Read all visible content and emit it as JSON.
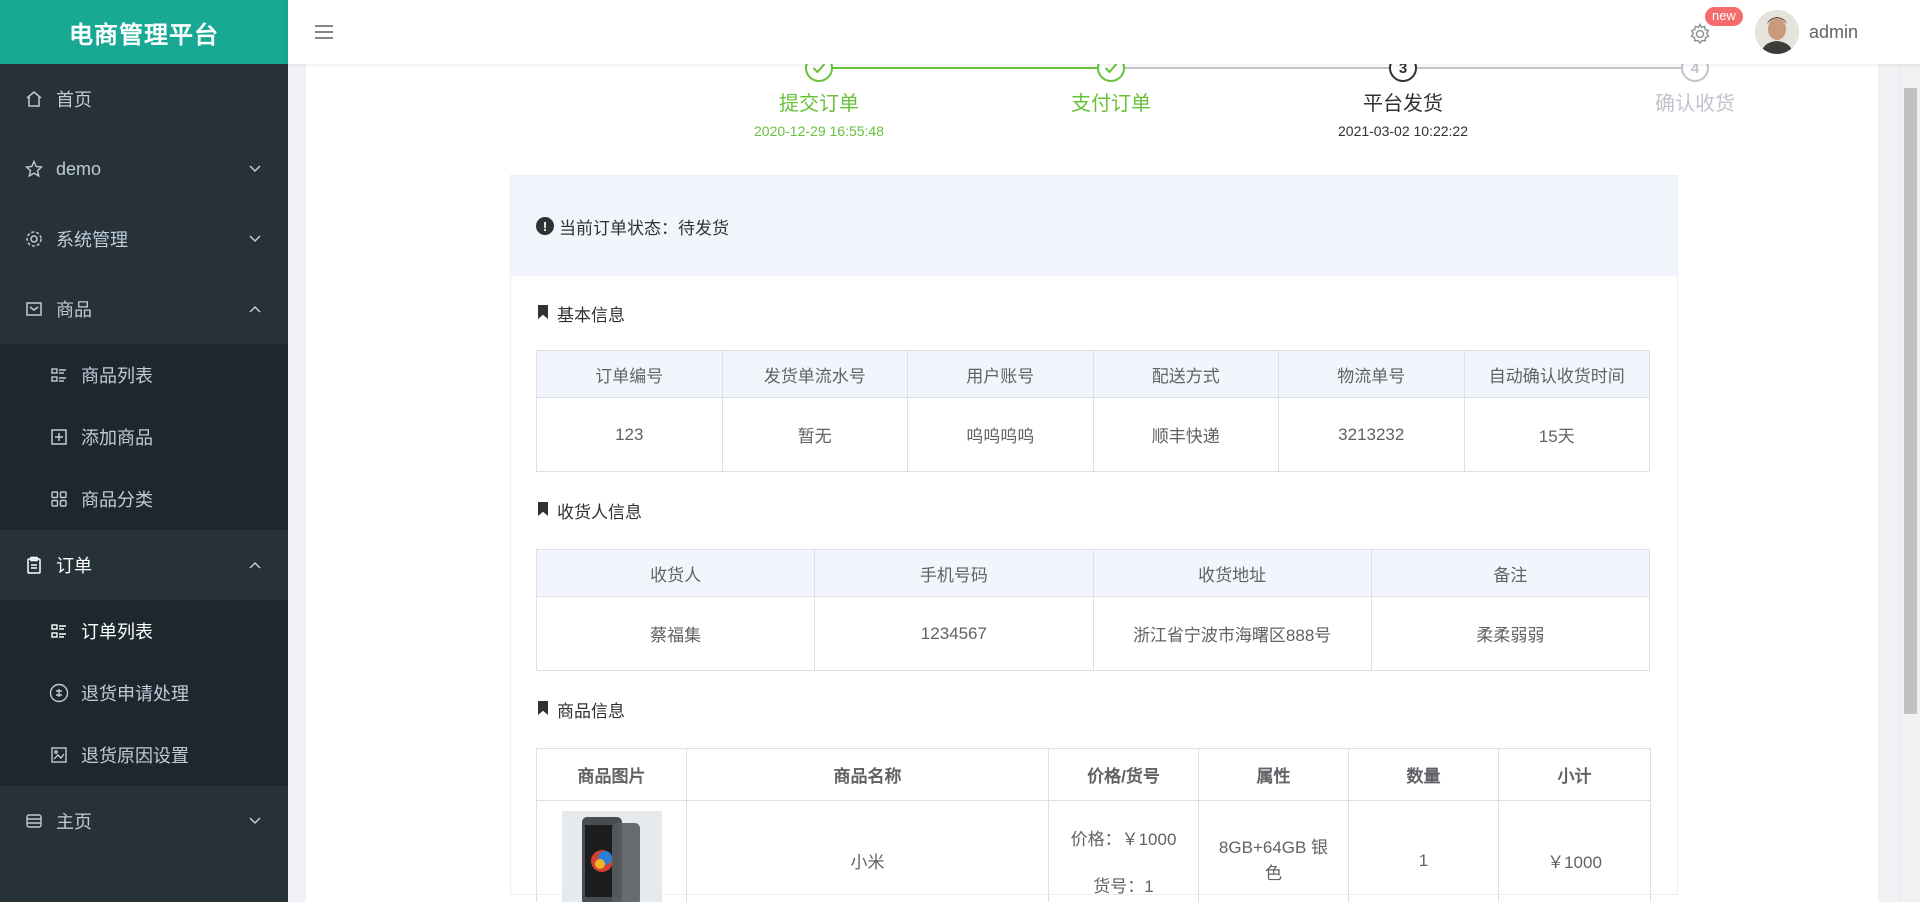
{
  "app": {
    "title": "电商管理平台"
  },
  "sidebar": {
    "items": [
      {
        "label": "首页",
        "icon": "home-icon"
      },
      {
        "label": "demo",
        "icon": "star-icon"
      },
      {
        "label": "系统管理",
        "icon": "gear-icon"
      },
      {
        "label": "商品",
        "icon": "inbox-icon"
      }
    ],
    "goods_sub": [
      {
        "label": "商品列表",
        "icon": "list-icon"
      },
      {
        "label": "添加商品",
        "icon": "plus-square-icon"
      },
      {
        "label": "商品分类",
        "icon": "grid-icon"
      }
    ],
    "order": {
      "label": "订单",
      "icon": "clipboard-icon"
    },
    "order_sub": [
      {
        "label": "订单列表",
        "icon": "list-icon"
      },
      {
        "label": "退货申请处理",
        "icon": "return-circle-icon"
      },
      {
        "label": "退货原因设置",
        "icon": "image-icon"
      }
    ],
    "homepage": {
      "label": "主页",
      "icon": "database-icon"
    }
  },
  "header": {
    "badge": "new",
    "username": "admin"
  },
  "steps": [
    {
      "title": "提交订单",
      "desc": "2020-12-29 16:55:48",
      "num": "",
      "state": "done"
    },
    {
      "title": "支付订单",
      "desc": "",
      "num": "",
      "state": "done"
    },
    {
      "title": "平台发货",
      "desc": "2021-03-02 10:22:22",
      "num": "3",
      "state": "process"
    },
    {
      "title": "确认收货",
      "desc": "",
      "num": "4",
      "state": "wait"
    }
  ],
  "status": {
    "text": "当前订单状态：待发货"
  },
  "basic": {
    "title": "基本信息",
    "headers": [
      "订单编号",
      "发货单流水号",
      "用户账号",
      "配送方式",
      "物流单号",
      "自动确认收货时间"
    ],
    "values": [
      "123",
      "暂无",
      "呜呜呜呜",
      "顺丰快递",
      "3213232",
      "15天"
    ]
  },
  "receiver": {
    "title": "收货人信息",
    "headers": [
      "收货人",
      "手机号码",
      "收货地址",
      "备注"
    ],
    "values": [
      "蔡福集",
      "1234567",
      "浙江省宁波市海曙区888号",
      "柔柔弱弱"
    ]
  },
  "goods": {
    "title": "商品信息",
    "headers": [
      "商品图片",
      "商品名称",
      "价格/货号",
      "属性",
      "数量",
      "小计"
    ],
    "row": {
      "name": "小米",
      "price": "价格：￥1000",
      "sku": "货号：1",
      "attr": "8GB+64GB 银色",
      "qty": "1",
      "subtotal": "￥1000"
    }
  }
}
